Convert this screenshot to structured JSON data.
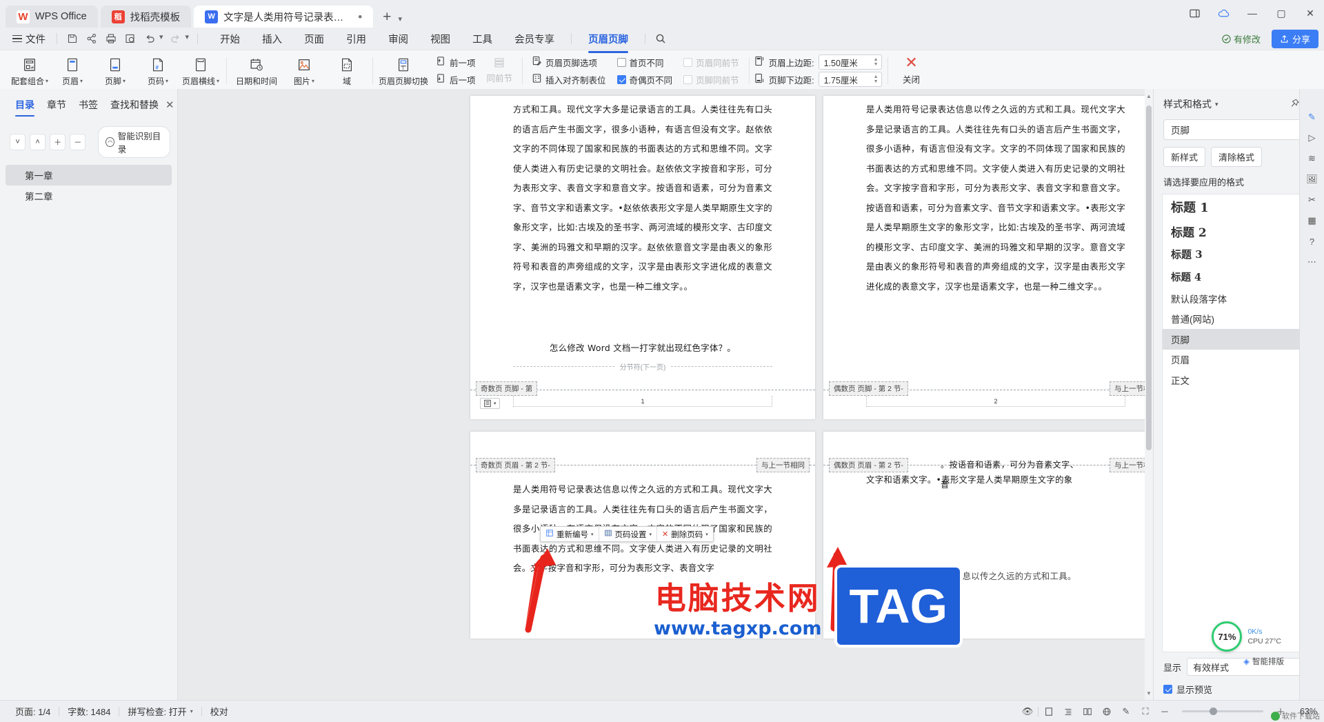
{
  "window": {
    "tabs": [
      {
        "label": "WPS Office",
        "icon": "wps-logo-icon",
        "active": false
      },
      {
        "label": "找稻壳模板",
        "icon": "template-icon",
        "active": false
      },
      {
        "label": "文字是人类用符号记录表达信息以",
        "icon": "word-doc-icon",
        "active": true
      }
    ],
    "new_tab_label": "+",
    "controls": [
      "panel-icon",
      "cloud-sync-icon",
      "minimize",
      "maximize",
      "close"
    ]
  },
  "menubar": {
    "file_label": "文件",
    "quick_icons": [
      "save-icon",
      "share-icon",
      "print-icon",
      "print-preview-icon",
      "undo-icon",
      "redo-icon",
      "more-icon"
    ],
    "tabs": [
      {
        "label": "开始",
        "active": false
      },
      {
        "label": "插入",
        "active": false
      },
      {
        "label": "页面",
        "active": false
      },
      {
        "label": "引用",
        "active": false
      },
      {
        "label": "审阅",
        "active": false
      },
      {
        "label": "视图",
        "active": false
      },
      {
        "label": "工具",
        "active": false
      },
      {
        "label": "会员专享",
        "active": false
      },
      {
        "label": "页眉页脚",
        "active": true
      }
    ],
    "search_icon": "search-icon",
    "edit_status": "有修改",
    "share_label": "分享"
  },
  "ribbon": {
    "group1": [
      {
        "label": "配套组合",
        "icon": "header-footer-combo-icon",
        "caret": true
      },
      {
        "label": "页眉",
        "icon": "header-icon",
        "caret": true
      },
      {
        "label": "页脚",
        "icon": "footer-icon",
        "caret": true
      },
      {
        "label": "页码",
        "icon": "page-number-icon",
        "caret": true
      },
      {
        "label": "页眉横线",
        "icon": "header-line-icon",
        "caret": true
      }
    ],
    "group2": [
      {
        "label": "日期和时间",
        "icon": "date-time-icon",
        "caret": false
      },
      {
        "label": "图片",
        "icon": "picture-icon",
        "caret": true
      },
      {
        "label": "域",
        "icon": "field-icon",
        "caret": false
      }
    ],
    "group3": {
      "switch_label": "页眉页脚切换",
      "switch_icon": "switch-header-footer-icon",
      "prev_label": "前一项",
      "prev_icon": "prev-item-icon",
      "next_label": "后一项",
      "next_icon": "next-item-icon",
      "same_as_prev_label": "同前节",
      "same_as_prev_icon": "same-as-previous-icon"
    },
    "group4": {
      "options_label": "页眉页脚选项",
      "options_icon": "header-footer-options-icon",
      "align_tab_label": "插入对齐制表位",
      "align_tab_icon": "align-tab-icon",
      "checks": [
        {
          "label": "首页不同",
          "checked": false,
          "disabled": false
        },
        {
          "label": "奇偶页不同",
          "checked": true,
          "disabled": false
        },
        {
          "label": "页眉同前节",
          "checked": false,
          "disabled": true
        },
        {
          "label": "页脚同前节",
          "checked": false,
          "disabled": true
        }
      ]
    },
    "group5": {
      "header_margin_label": "页眉上边距:",
      "header_margin_value": "1.50厘米",
      "header_margin_icon": "header-margin-icon",
      "footer_margin_label": "页脚下边距:",
      "footer_margin_value": "1.75厘米",
      "footer_margin_icon": "footer-margin-icon"
    },
    "close": {
      "label": "关闭",
      "icon": "close-x-icon"
    }
  },
  "left_panel": {
    "tabs": [
      {
        "label": "目录",
        "active": true
      },
      {
        "label": "章节",
        "active": false
      },
      {
        "label": "书签",
        "active": false
      },
      {
        "label": "查找和替换",
        "active": false
      }
    ],
    "close_icon": "close-icon",
    "tools": [
      "expand-down-icon",
      "collapse-up-icon",
      "add-icon",
      "remove-icon"
    ],
    "smart_button": {
      "label": "智能识别目录",
      "icon": "smart-recognize-icon"
    },
    "items": [
      {
        "label": "第一章",
        "selected": true
      },
      {
        "label": "第二章",
        "selected": false
      }
    ]
  },
  "document": {
    "page1_left": {
      "body": "方式和工具。现代文字大多是记录语言的工具。人类往往先有口头的语言后产生书面文字，很多小语种，有语言但没有文字。赵依依文字的不同体现了国家和民族的书面表达的方式和思维不同。文字使人类进入有历史记录的文明社会。赵依依文字按音和字形，可分为表形文字、表音文字和意音文字。按语音和语素，可分为音素文字、音节文字和语素文字。•赵依依表形文字是人类早期原生文字的象形文字，比如:古埃及的圣书字、两河流域的模形文字、古印度文字、美洲的玛雅文和早期的汉字。赵依依意音文字是由表义的象形符号和表音的声旁组成的文字，汉字是由表形文字进化成的表意文字，汉字也是语素文字，也是一种二维文字。。",
      "center_note": "怎么修改 Word 文档一打字就出现红色字体？。",
      "break_label": "分节符(下一页)",
      "footer_tag": "奇数页 页脚 - 第",
      "page_number": "1"
    },
    "page1_right": {
      "body": "是人类用符号记录表达信息以传之久远的方式和工具。现代文字大多是记录语言的工具。人类往往先有口头的语言后产生书面文字，很多小语种，有语言但没有文字。文字的不同体现了国家和民族的书面表达的方式和思维不同。文字使人类进入有历史记录的文明社会。文字按字音和字形，可分为表形文字、表音文字和意音文字。按语音和语素，可分为音素文字、音节文字和语素文字。•表形文字是人类早期原生文字的象形文字，比如:古埃及的圣书字、两河流域的模形文字、古印度文字、美洲的玛雅文和早期的汉字。意音文字是由表义的象形符号和表音的声旁组成的文字，汉字是由表形文字进化成的表意文字，汉字也是语素文字，也是一种二维文字。。",
      "footer_tag": "偶数页 页脚 - 第 2 节-",
      "same_as_prev": "与上一节相同",
      "page_number": "2"
    },
    "page2_left": {
      "header_tag": "奇数页 页眉 - 第 2 节-",
      "same_as_prev": "与上一节相同",
      "body": "是人类用符号记录表达信息以传之久远的方式和工具。现代文字大多是记录语言的工具。人类往往先有口头的语言后产生书面文字，很多小语种，有语言但没有文字。文字的不同体现了国家和民族的书面表达的方式和思维不同。文字使人类进入有历史记录的文明社会。文字按字音和字形，可分为表形文字、表音文字"
    },
    "page2_right": {
      "header_tag": "偶数页 页眉 - 第 2 节-",
      "header_text": "。按语音和语素，可分为音素文字、音",
      "same_as_prev": "与上一节相同",
      "body_line1": "文字和语素文字。•表形文字是人类早期原生文字的象",
      "body_tail": "是人类用符号记录表达信息以传之久远的方式和工具。"
    },
    "page_number_toolbar": {
      "renumber": {
        "label": "重新编号",
        "icon": "renumber-icon",
        "caret": true
      },
      "settings": {
        "label": "页码设置",
        "icon": "page-number-settings-icon",
        "caret": true
      },
      "delete": {
        "label": "删除页码",
        "icon": "delete-x-icon",
        "caret": true
      }
    },
    "footer_field_icon": {
      "icon": "field-options-icon",
      "caret": true
    }
  },
  "watermark": {
    "cn": "电脑技术网",
    "url": "www.tagxp.com",
    "tag": "TAG"
  },
  "right_panel": {
    "title": "样式和格式",
    "title_caret": "chevron-down-icon",
    "pin_icon": "pin-icon",
    "close_icon": "close-icon",
    "current_style": "页脚",
    "new_style_label": "新样式",
    "clear_format_label": "清除格式",
    "hint": "请选择要应用的格式",
    "styles": [
      {
        "label": "标题 1",
        "cls": "s-h1",
        "mark": "¶",
        "selected": false
      },
      {
        "label": "标题 2",
        "cls": "s-h2",
        "mark": "¶",
        "selected": false
      },
      {
        "label": "标题 3",
        "cls": "s-h3",
        "mark": "¶",
        "selected": false
      },
      {
        "label": "标题 4",
        "cls": "s-h4",
        "mark": "¶",
        "selected": false
      },
      {
        "label": "默认段落字体",
        "cls": "",
        "mark": "a",
        "selected": false
      },
      {
        "label": "普通(网站)",
        "cls": "",
        "mark": "¶",
        "selected": false
      },
      {
        "label": "页脚",
        "cls": "",
        "mark": "¶",
        "selected": true
      },
      {
        "label": "页眉",
        "cls": "",
        "mark": "¶",
        "selected": false
      },
      {
        "label": "正文",
        "cls": "",
        "mark": "¶",
        "selected": false
      }
    ],
    "show_label": "显示",
    "show_value": "有效样式",
    "preview_label": "显示预览"
  },
  "rail": [
    "pen-icon",
    "cursor-icon",
    "stack-icon",
    "image-icon",
    "scissors-icon",
    "grid-icon",
    "help-icon",
    "more-dots-icon"
  ],
  "cpu_widget": {
    "gauge_value": "71%",
    "net_speed": "0K/s",
    "cpu_temp": "CPU 27°C",
    "smart_panel": "智能排版"
  },
  "statusbar": {
    "page": "页面: 1/4",
    "words": "字数: 1484",
    "spellcheck": "拼写检查: 打开",
    "proofread": "校对",
    "right_icons": [
      "eye-icon",
      "page-view-icon",
      "outline-view-icon",
      "reading-view-icon",
      "web-view-icon",
      "pen-icon",
      "fullscreen-icon"
    ],
    "zoom": "63%",
    "brand": "软件下载站"
  }
}
